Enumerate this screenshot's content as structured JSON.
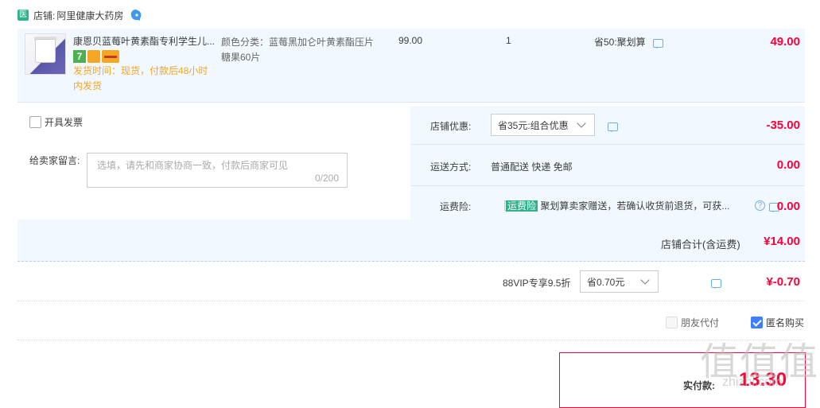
{
  "shop": {
    "badge": "医",
    "label": "店铺:",
    "name": "阿里健康大药房"
  },
  "item": {
    "title": "康恩贝蓝莓叶黄素酯专利学生儿...",
    "badge_7": "7",
    "ship_time": "发货时间：现货，付款后48小时内发货",
    "sku": "颜色分类：蓝莓黑加仑叶黄素酯压片糖果60片",
    "price": "99.00",
    "quantity": "1",
    "promo": "省50:聚划算",
    "total": "49.00"
  },
  "invoice": {
    "label": "开具发票"
  },
  "memo": {
    "label": "给卖家留言:",
    "placeholder": "选填，请先和商家协商一致，付款后商家可见",
    "count": "0/200"
  },
  "shop_discount": {
    "label": "店铺优惠:",
    "selected": "省35元:组合优惠",
    "value": "-35.00"
  },
  "shipping": {
    "label": "运送方式:",
    "text": "普通配送 快递 免邮",
    "value": "0.00"
  },
  "freight_insurance": {
    "label": "运费险:",
    "tag": "运费险",
    "text": "聚划算卖家赠送，若确认收货前退货，可获...",
    "value": "0.00"
  },
  "subtotal": {
    "label": "店铺合计(含运费)",
    "value": "¥14.00"
  },
  "vip": {
    "label": "88VIP专享9.5折",
    "selected": "省0.70元",
    "value": "¥-0.70"
  },
  "options": {
    "friend_pay": "朋友代付",
    "anonymous": "匿名购买"
  },
  "pay": {
    "label": "实付款:",
    "amount": "13.30"
  },
  "watermark": {
    "main": "值值值",
    "sub": "zhizhi.com"
  },
  "colors": {
    "accent_red": "#ff0036",
    "panel_blue": "#f2f8ff",
    "check_blue": "#3d7fff",
    "tag_green": "#2fb28c",
    "warn_orange": "#f5a623"
  },
  "icons": [
    "medicine-badge-icon",
    "wangwang-chat-icon",
    "message-icon",
    "question-icon",
    "chevron-down-icon"
  ]
}
